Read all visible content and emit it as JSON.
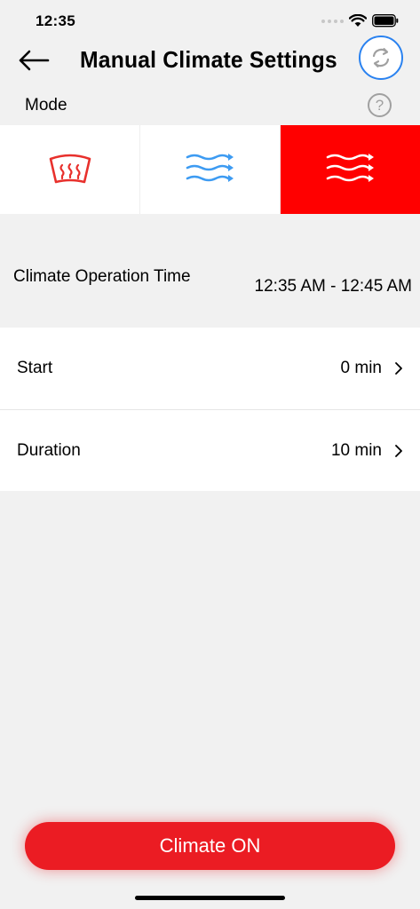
{
  "status_bar": {
    "time": "12:35"
  },
  "header": {
    "title": "Manual Climate Settings",
    "back_icon": "arrow-left-icon",
    "refresh_icon": "refresh-icon"
  },
  "mode": {
    "label": "Mode",
    "help_icon": "?",
    "options": [
      {
        "icon": "defrost-icon",
        "active": false
      },
      {
        "icon": "airflow-icon",
        "active": false
      },
      {
        "icon": "airflow-icon",
        "active": true
      }
    ]
  },
  "operation_time": {
    "label": "Climate Operation Time",
    "value": "12:35 AM - 12:45 AM"
  },
  "settings": [
    {
      "label": "Start",
      "value": "0 min"
    },
    {
      "label": "Duration",
      "value": "10 min"
    }
  ],
  "footer": {
    "button_label": "Climate ON"
  },
  "colors": {
    "accent": "#eb1c23",
    "active_tab": "#ff0000",
    "airflow_blue": "#3d9bf2",
    "refresh_border": "#2a82f0"
  }
}
